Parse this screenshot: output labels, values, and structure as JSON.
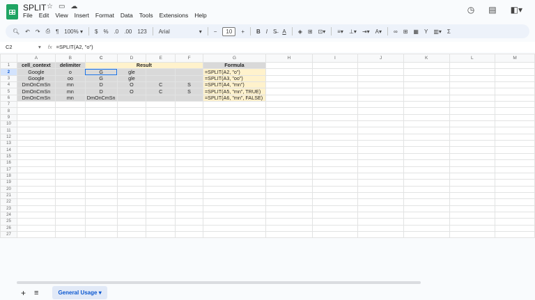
{
  "doc": {
    "title": "SPLIT"
  },
  "menu": [
    "File",
    "Edit",
    "View",
    "Insert",
    "Format",
    "Data",
    "Tools",
    "Extensions",
    "Help"
  ],
  "toolbar": {
    "zoom": "100%",
    "currency": "$",
    "percent": "%",
    "dec_dec": ".0",
    "inc_dec": ".00",
    "number_format": "123",
    "font": "Arial",
    "font_size": "10",
    "bold": "B",
    "italic": "I"
  },
  "formula_bar": {
    "cell_ref": "C2",
    "formula": "=SPLIT(A2, \"o\")"
  },
  "columns": [
    "A",
    "B",
    "C",
    "D",
    "E",
    "F",
    "G",
    "H",
    "I",
    "J",
    "K",
    "L",
    "M"
  ],
  "headers": {
    "a": "cell_context",
    "b": "delimiter",
    "result": "Result",
    "formula": "Formula"
  },
  "rows": [
    {
      "a": "Google",
      "b": "o",
      "c": "G",
      "d": "gle",
      "e": "",
      "f": "",
      "g": "=SPLIT(A2, \"o\")"
    },
    {
      "a": "Google",
      "b": "oo",
      "c": "G",
      "d": "gle",
      "e": "",
      "f": "",
      "g": "=SPLIT(A3, \"oo\")"
    },
    {
      "a": "DmOnCmSn",
      "b": "mn",
      "c": "D",
      "d": "O",
      "e": "C",
      "f": "S",
      "g": "=SPLIT(A4, \"mn\")"
    },
    {
      "a": "DmOnCmSn",
      "b": "mn",
      "c": "D",
      "d": "O",
      "e": "C",
      "f": "S",
      "g": "=SPLIT(A5, \"mn\", TRUE)"
    },
    {
      "a": "DmOnCmSn",
      "b": "mn",
      "c": "DmOnCmSn",
      "d": "",
      "e": "",
      "f": "",
      "g": "=SPLIT(A6, \"mn\", FALSE)"
    }
  ],
  "sheet_tabs": [
    {
      "label": "General Usage",
      "active": true
    }
  ]
}
